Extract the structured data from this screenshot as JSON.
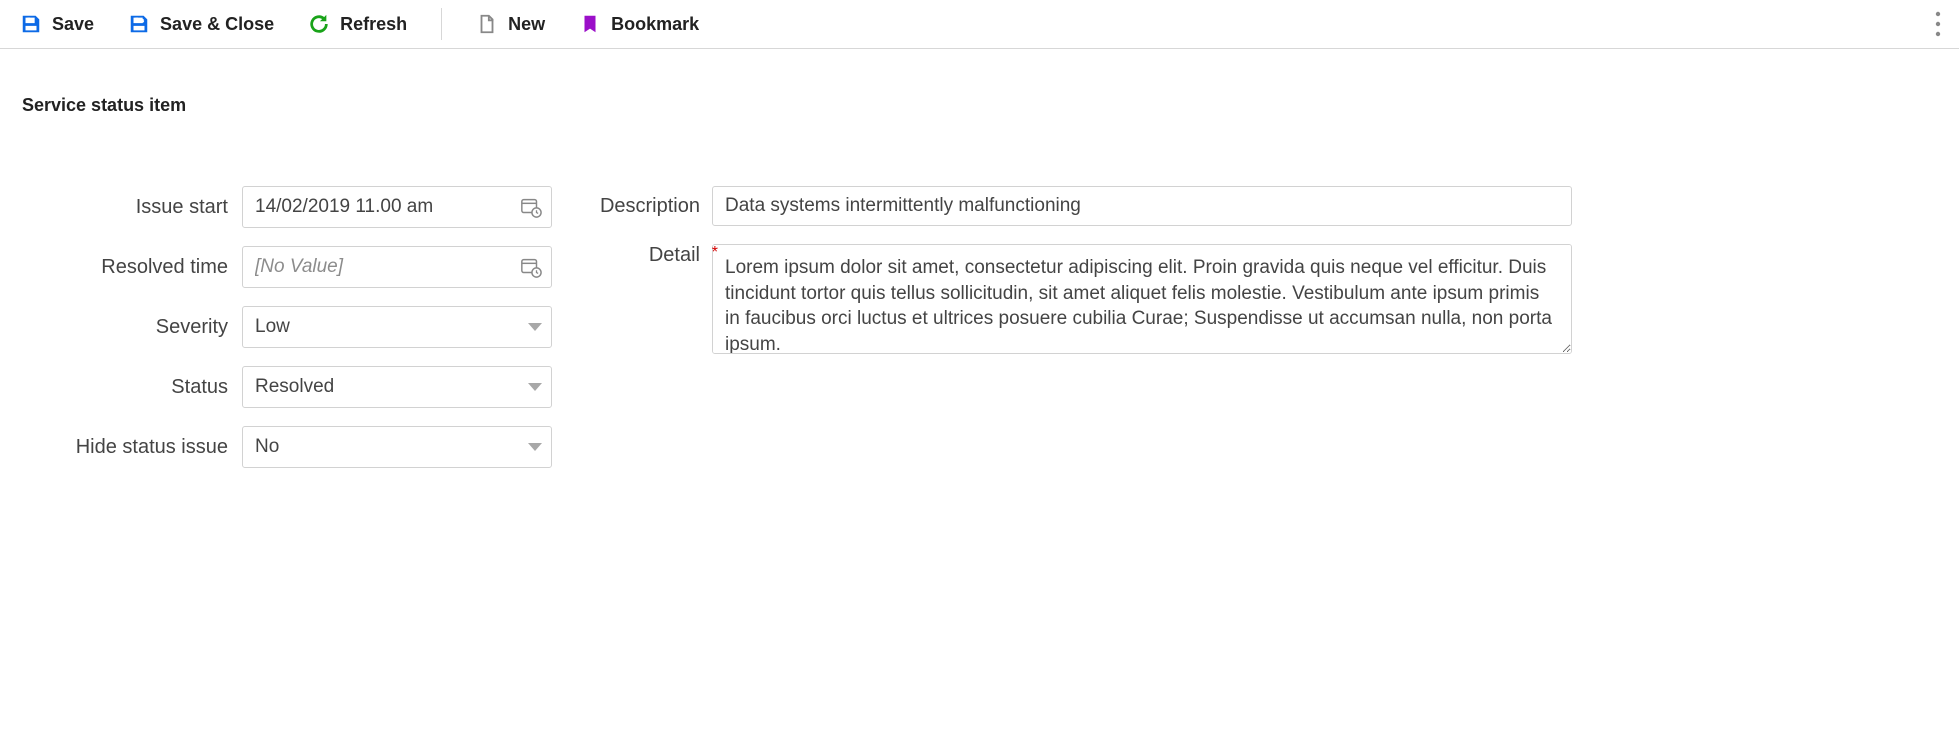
{
  "toolbar": {
    "save": "Save",
    "save_close": "Save & Close",
    "refresh": "Refresh",
    "new": "New",
    "bookmark": "Bookmark"
  },
  "section_title": "Service status item",
  "form": {
    "issue_start": {
      "label": "Issue start",
      "value": "14/02/2019 11.00 am"
    },
    "resolved_time": {
      "label": "Resolved time",
      "placeholder": "[No Value]",
      "value": ""
    },
    "severity": {
      "label": "Severity",
      "value": "Low"
    },
    "status": {
      "label": "Status",
      "value": "Resolved"
    },
    "hide_status_issue": {
      "label": "Hide status issue",
      "value": "No"
    },
    "description": {
      "label": "Description",
      "value": "Data systems intermittently malfunctioning"
    },
    "detail": {
      "label": "Detail",
      "required_marker": "*",
      "value": "Lorem ipsum dolor sit amet, consectetur adipiscing elit. Proin gravida quis neque vel efficitur. Duis tincidunt tortor quis tellus sollicitudin, sit amet aliquet felis molestie. Vestibulum ante ipsum primis in faucibus orci luctus et ultrices posuere cubilia Curae; Suspendisse ut accumsan nulla, non porta ipsum."
    }
  }
}
